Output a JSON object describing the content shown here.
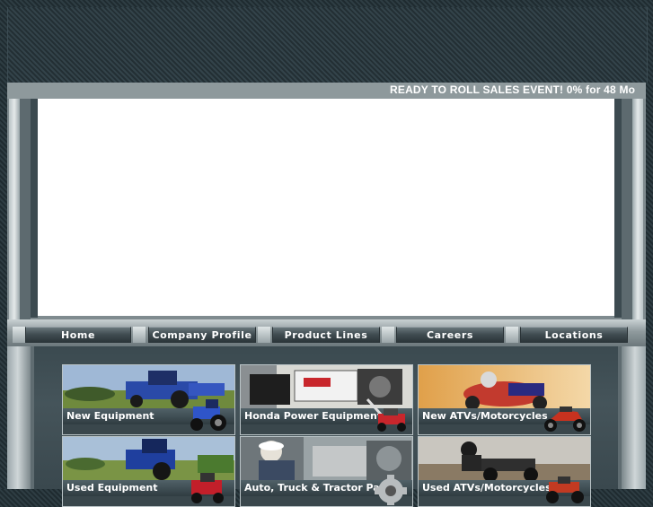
{
  "ticker": {
    "text": "READY TO ROLL SALES EVENT! 0% for 48 Mo"
  },
  "nav": {
    "items": [
      {
        "label": "Home"
      },
      {
        "label": "Company Profile"
      },
      {
        "label": "Product Lines"
      },
      {
        "label": "Careers"
      },
      {
        "label": "Locations"
      }
    ]
  },
  "tiles": [
    {
      "label": "New Equipment",
      "icon": "tractor-image"
    },
    {
      "label": "Honda Power Equipment",
      "icon": "mower-image"
    },
    {
      "label": "New ATVs/Motorcycles",
      "icon": "motorcycle-image"
    },
    {
      "label": "Used Equipment",
      "icon": "tractor-image"
    },
    {
      "label": "Auto, Truck & Tractor Parts",
      "icon": "parts-image"
    },
    {
      "label": "Used ATVs/Motorcycles",
      "icon": "atv-image"
    }
  ],
  "colors": {
    "background": "#26343a",
    "ticker_bar": "#8e999c",
    "banner": "#ffffff",
    "nav_button": "#3f4b50",
    "tile_caption": "#2f3c41"
  }
}
